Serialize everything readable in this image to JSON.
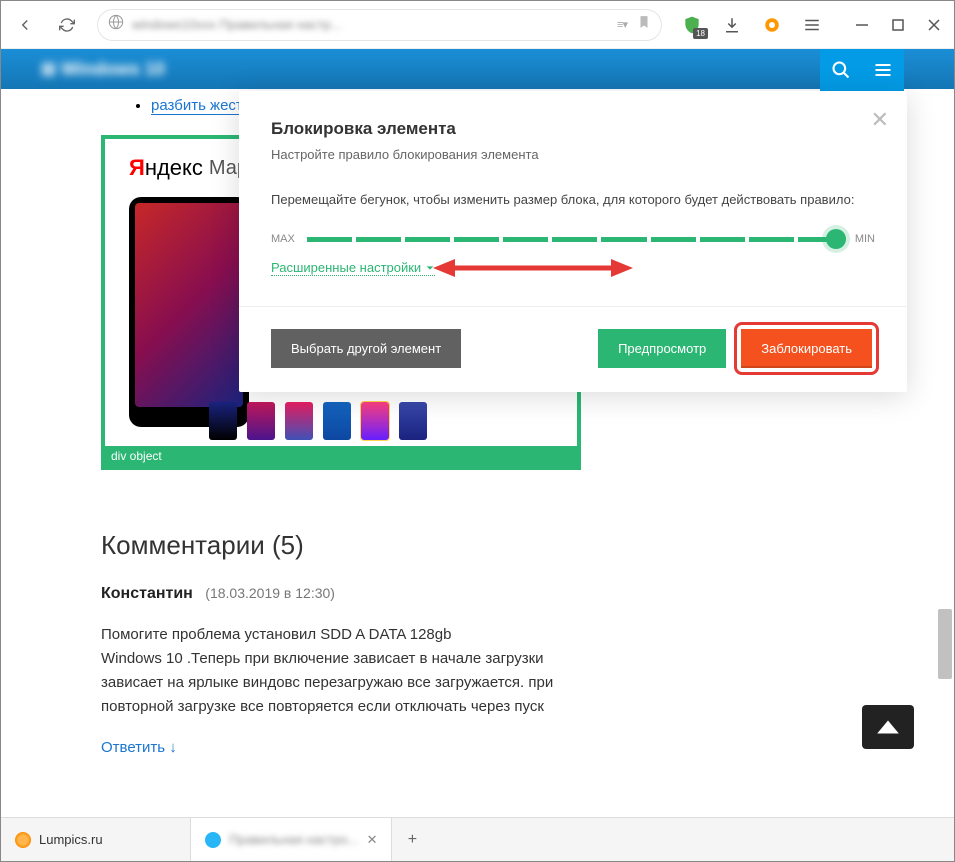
{
  "toolbar": {
    "shield_badge": "18"
  },
  "page": {
    "link_text": "разбить жестки",
    "ad_brand_y": "Я",
    "ad_brand_rest": "ндекс",
    "ad_brand_market": "Маркет",
    "ad_selector_label": "div object",
    "comments_heading": "Комментарии (5)",
    "comment_author": "Константин",
    "comment_date": "(18.03.2019 в 12:30)",
    "comment_body_1": "Помогите проблема установил SDD A DATA 128gb",
    "comment_body_2": "Windows 10 .Теперь при включение зависает в начале загрузки зависает на ярлыке виндовс перезагружаю все загружается. при повторной загрузке все повторяется если отключать через пуск",
    "reply_label": "Ответить ↓"
  },
  "modal": {
    "title": "Блокировка элемента",
    "subtitle": "Настройте правило блокирования элемента",
    "instruction": "Перемещайте бегунок, чтобы изменить размер блока, для которого будет действовать правило:",
    "max_label": "MAX",
    "min_label": "MIN",
    "advanced_label": "Расширенные настройки",
    "btn_other": "Выбрать другой элемент",
    "btn_preview": "Предпросмотр",
    "btn_block": "Заблокировать"
  },
  "tabs": {
    "tab1_label": "Lumpics.ru"
  }
}
